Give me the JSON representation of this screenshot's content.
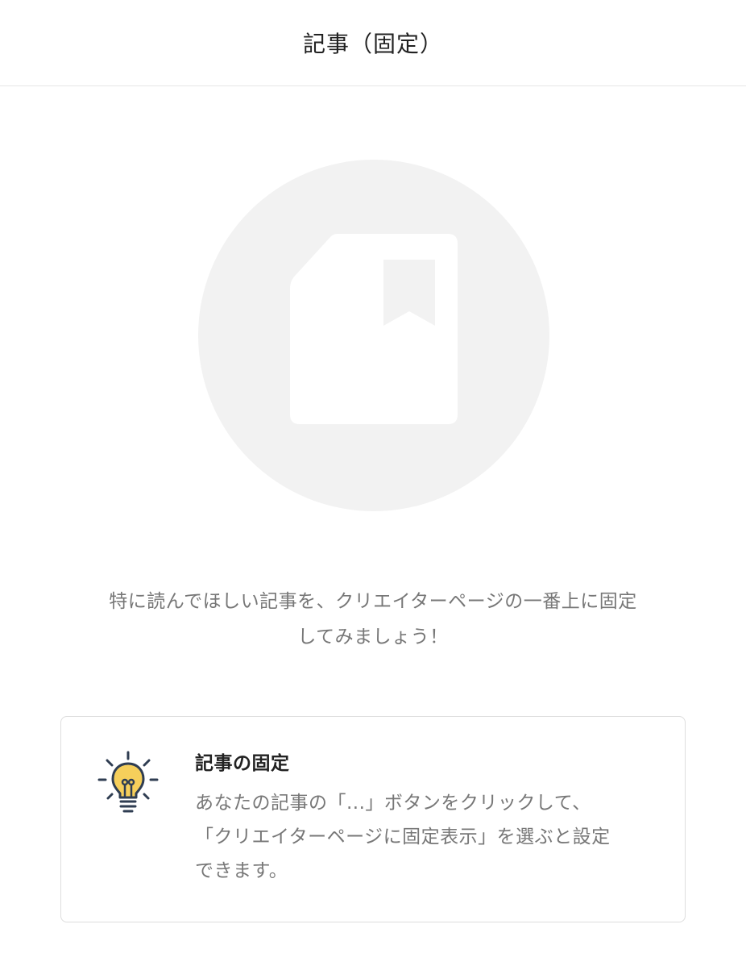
{
  "header": {
    "title": "記事（固定）"
  },
  "empty_state": {
    "icon": "pinned-article-icon",
    "message_line1": "特に読んでほしい記事を、クリエイターページの一番上に固定",
    "message_line2": "してみましょう！"
  },
  "tip": {
    "icon": "lightbulb-icon",
    "title": "記事の固定",
    "body_line1": "あなたの記事の「...」ボタンをクリックして、",
    "body_line2": "「クリエイターページに固定表示」を選ぶと設定",
    "body_line3": "できます。"
  },
  "colors": {
    "circle_bg": "#f2f2f2",
    "bulb_yellow": "#f6cf5b",
    "bulb_navy": "#2f3d52",
    "text_gray": "#777777"
  }
}
